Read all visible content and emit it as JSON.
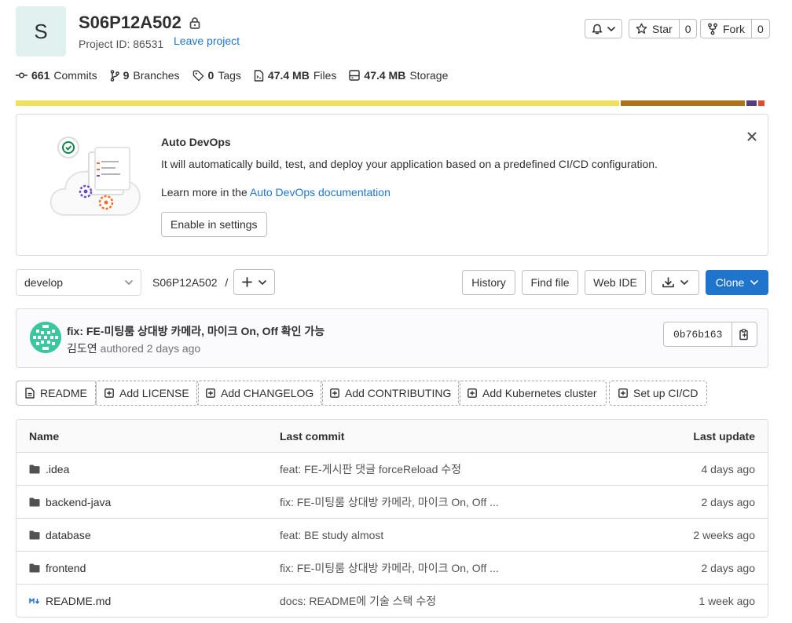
{
  "project": {
    "avatar_letter": "S",
    "name": "S06P12A502",
    "id_label": "Project ID: 86531",
    "leave_label": "Leave project"
  },
  "header_buttons": {
    "star_label": "Star",
    "star_count": "0",
    "fork_label": "Fork",
    "fork_count": "0"
  },
  "stats": {
    "commits_count": "661",
    "commits_label": "Commits",
    "branches_count": "9",
    "branches_label": "Branches",
    "tags_count": "0",
    "tags_label": "Tags",
    "files_size": "47.4 MB",
    "files_label": "Files",
    "storage_size": "47.4 MB",
    "storage_label": "Storage"
  },
  "languages": [
    {
      "share": 0.807,
      "color": "#f1e05a"
    },
    {
      "share": 0.166,
      "color": "#b07219"
    },
    {
      "share": 0.014,
      "color": "#563d7c"
    },
    {
      "share": 0.008,
      "color": "#e34c26"
    }
  ],
  "devops": {
    "title": "Auto DevOps",
    "description": "It will automatically build, test, and deploy your application based on a predefined CI/CD configuration.",
    "learn_prefix": "Learn more in the ",
    "learn_link": "Auto DevOps documentation",
    "enable_button": "Enable in settings"
  },
  "toolbar": {
    "branch": "develop",
    "breadcrumb": "S06P12A502",
    "separator": "/",
    "history": "History",
    "find_file": "Find file",
    "web_ide": "Web IDE",
    "clone": "Clone"
  },
  "last_commit": {
    "title": "fix: FE-미팅룸 상대방 카메라, 마이크 On, Off 확인 가능",
    "author": "김도연",
    "authored": "authored 2 days ago",
    "sha": "0b76b163"
  },
  "quick_actions": {
    "readme": "README",
    "add_license": "Add LICENSE",
    "add_changelog": "Add CHANGELOG",
    "add_contributing": "Add CONTRIBUTING",
    "add_kubernetes": "Add Kubernetes cluster",
    "setup_cicd": "Set up CI/CD"
  },
  "files": {
    "headers": {
      "name": "Name",
      "last_commit": "Last commit",
      "last_update": "Last update"
    },
    "rows": [
      {
        "name": ".idea",
        "icon": "folder-icon",
        "commit": "feat: FE-게시판 댓글 forceReload 수정",
        "updated": "4 days ago"
      },
      {
        "name": "backend-java",
        "icon": "folder-icon",
        "commit": "fix: FE-미팅룸 상대방 카메라, 마이크 On, Off ...",
        "updated": "2 days ago"
      },
      {
        "name": "database",
        "icon": "folder-icon",
        "commit": "feat: BE study almost",
        "updated": "2 weeks ago"
      },
      {
        "name": "frontend",
        "icon": "folder-icon",
        "commit": "fix: FE-미팅룸 상대방 카메라, 마이크 On, Off ...",
        "updated": "2 days ago"
      },
      {
        "name": "README.md",
        "icon": "markdown-icon",
        "commit": "docs: README에 기술 스택 수정",
        "updated": "1 week ago"
      }
    ]
  }
}
